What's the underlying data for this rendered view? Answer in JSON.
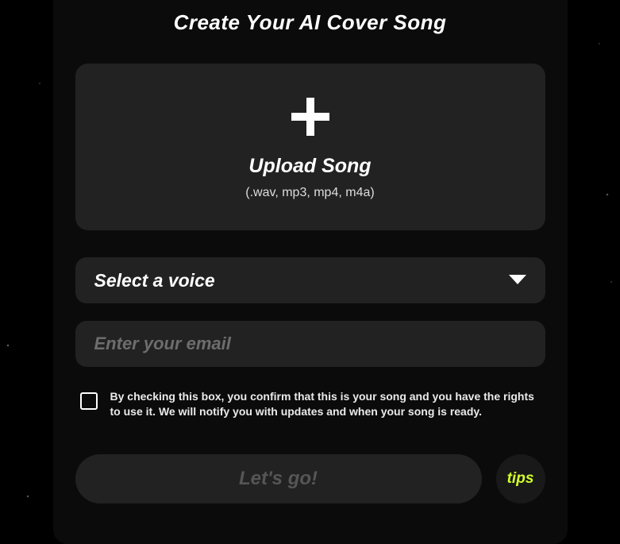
{
  "title": "Create Your AI Cover Song",
  "upload": {
    "label": "Upload Song",
    "formats": "(.wav, mp3, mp4, m4a)"
  },
  "voice_select": {
    "placeholder": "Select a voice"
  },
  "email": {
    "placeholder": "Enter your email",
    "value": ""
  },
  "consent": {
    "checked": false,
    "text": "By checking this box, you confirm that this is your song and you have the rights to use it. We will notify you with updates and when your song is ready."
  },
  "submit": {
    "label": "Let's go!"
  },
  "tips": {
    "label": "tips"
  }
}
